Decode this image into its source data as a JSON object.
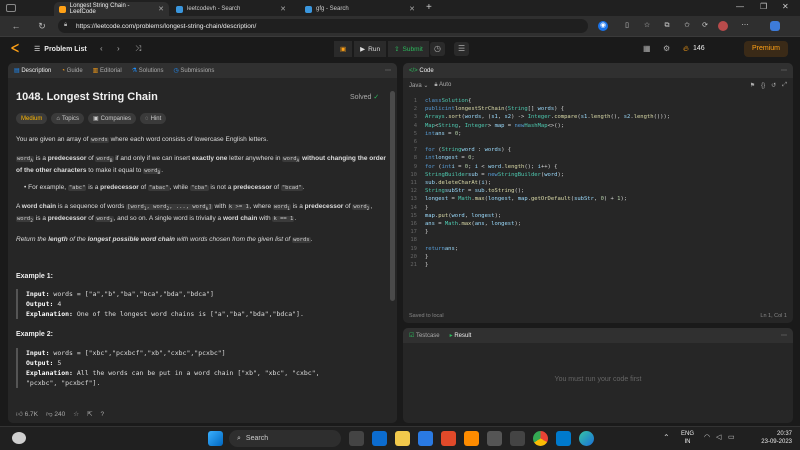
{
  "browser": {
    "tabs": [
      {
        "label": "Longest String Chain - LeetCode",
        "favicon_color": "#ffa116"
      },
      {
        "label": "leetcodevh - Search",
        "favicon_color": "#3a96dd"
      },
      {
        "label": "gfg - Search",
        "favicon_color": "#3a96dd"
      }
    ],
    "url": "https://leetcode.com/problems/longest-string-chain/description/"
  },
  "header": {
    "problem_list": "Problem List",
    "run": "Run",
    "submit": "Submit",
    "streak": "146",
    "premium": "Premium"
  },
  "description": {
    "tabs": [
      "Description",
      "Guide",
      "Editorial",
      "Solutions",
      "Submissions"
    ],
    "title": "1048. Longest String Chain",
    "solved": "Solved",
    "chips": [
      "Medium",
      "Topics",
      "Companies",
      "Hint"
    ],
    "p1": "You are given an array of",
    "p1_code": "words",
    "p1_end": "where each word consists of lowercase English letters.",
    "p2_a": "word",
    "p2_a_sub": "A",
    "p2_b": "is a",
    "p2_c": "predecessor",
    "p2_d": "of",
    "p2_e": "word",
    "p2_e_sub": "B",
    "p2_f": "if and only if we can insert",
    "p2_g": "exactly one",
    "p2_h": "letter anywhere in",
    "p2_i": "word",
    "p2_i_sub": "A",
    "p2_j": "without changing the order of the other characters",
    "p2_k": "to make it equal to",
    "p2_l": "word",
    "p2_l_sub": "B",
    "p2_end": ".",
    "bullet_a": "For example,",
    "bullet_b": "\"abc\"",
    "bullet_c": "is a",
    "bullet_d": "predecessor",
    "bullet_e": "of",
    "bullet_f": "\"abac\"",
    "bullet_g": ", while",
    "bullet_h": "\"cba\"",
    "bullet_i": "is not a",
    "bullet_j": "predecessor",
    "bullet_k": "of",
    "bullet_l": "\"bcad\"",
    "bullet_end": ".",
    "p3_a": "A",
    "p3_b": "word chain",
    "p3_c": "is a sequence of words",
    "p3_d": "[word",
    "p3_d_sub1": "1",
    "p3_d2": ", word",
    "p3_d_sub2": "2",
    "p3_d3": ", ..., word",
    "p3_d_sub3": "k",
    "p3_d4": "]",
    "p3_e": "with",
    "p3_f": "k >= 1",
    "p3_g": ", where",
    "p3_h": "word",
    "p3_h_sub": "1",
    "p3_i": "is a",
    "p3_j": "predecessor",
    "p3_k": "of",
    "p3_l": "word",
    "p3_l_sub": "2",
    "p3_m": ",",
    "p3_n": "word",
    "p3_n_sub": "2",
    "p3_o": "is a",
    "p3_p": "predecessor",
    "p3_q": "of",
    "p3_r": "word",
    "p3_r_sub": "3",
    "p3_s": ", and so on. A single word is trivially a",
    "p3_t": "word chain",
    "p3_u": "with",
    "p3_v": "k == 1",
    "p3_end": ".",
    "p4_a": "Return",
    "p4_b": "the",
    "p4_c": "length",
    "p4_d": "of the",
    "p4_e": "longest possible word chain",
    "p4_f": "with words chosen from the given list of",
    "p4_g": "words",
    "p4_end": ".",
    "example1_title": "Example 1:",
    "example1": {
      "input_label": "Input:",
      "input": "words = [\"a\",\"b\",\"ba\",\"bca\",\"bda\",\"bdca\"]",
      "output_label": "Output:",
      "output": "4",
      "expl_label": "Explanation:",
      "expl": "One of the longest word chains is [\"a\",\"ba\",\"bda\",\"bdca\"]."
    },
    "example2_title": "Example 2:",
    "example2": {
      "input_label": "Input:",
      "input": "words = [\"xbc\",\"pcxbcf\",\"xb\",\"cxbc\",\"pcxbc\"]",
      "output_label": "Output:",
      "output": "5",
      "expl_label": "Explanation:",
      "expl1": "All the words can be put in a word chain [\"xb\", \"xbc\", \"cxbc\",",
      "expl2": "\"pcxbc\", \"pcxbcf\"]."
    },
    "likes": "6.7K",
    "dislikes": "240"
  },
  "code": {
    "tab": "Code",
    "language": "Java",
    "autocomplete": "Auto",
    "status_left": "Saved to local",
    "status_right": "Ln 1, Col 1"
  },
  "testpanel": {
    "tabs": [
      "Testcase",
      "Result"
    ],
    "message": "You must run your code first"
  },
  "taskbar": {
    "search": "Search",
    "lang1": "ENG",
    "lang2": "IN",
    "time": "20:37",
    "date": "23-09-2023"
  }
}
